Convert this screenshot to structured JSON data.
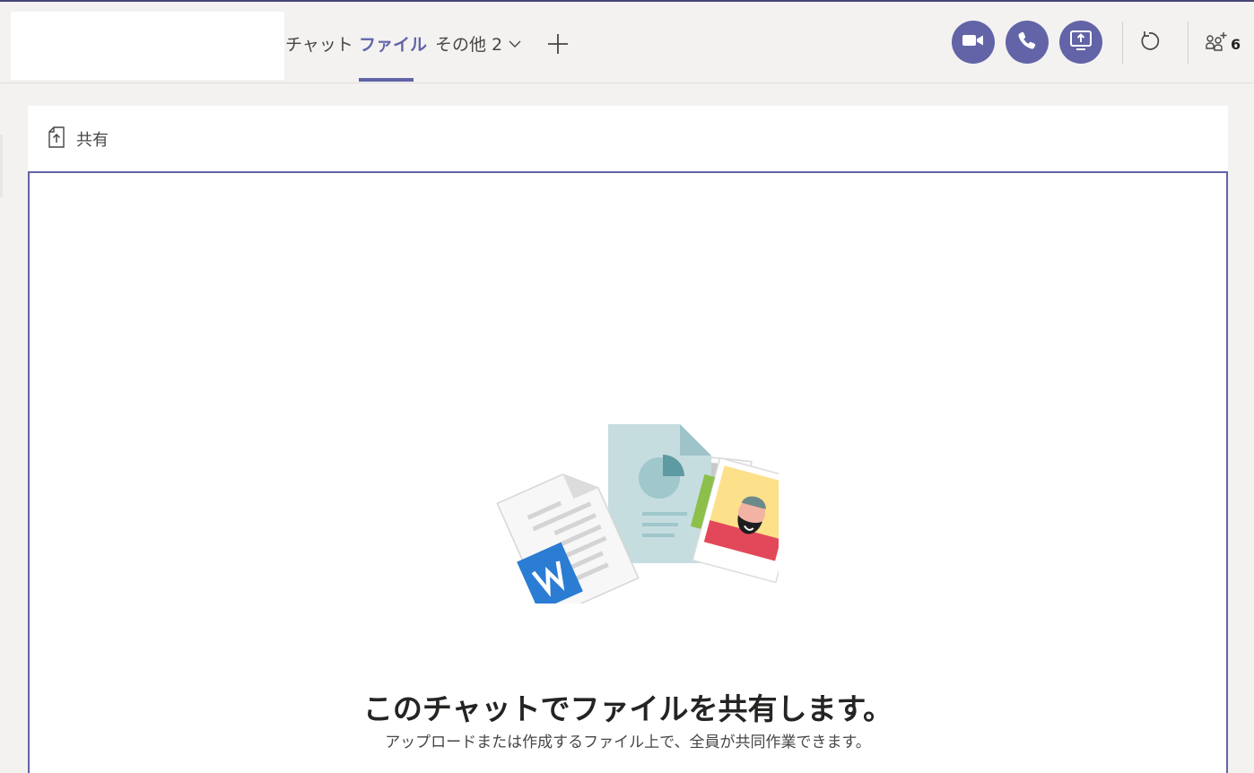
{
  "header": {
    "tabs": {
      "chat": "チャット",
      "files": "ファイル",
      "more": "その他 2"
    },
    "actions": {
      "video_icon": "video-camera-icon",
      "call_icon": "phone-icon",
      "share_icon": "screen-share-icon",
      "refresh_icon": "refresh-icon",
      "people_icon": "add-people-icon",
      "people_count": "6"
    }
  },
  "files": {
    "toolbar": {
      "share_label": "共有"
    },
    "empty_state": {
      "title": "このチャットでファイルを共有します。",
      "subtitle": "アップロードまたは作成するファイル上で、全員が共同作業できます。"
    }
  },
  "colors": {
    "accent": "#6264a7",
    "background": "#f3f2f1",
    "panel": "#ffffff"
  }
}
